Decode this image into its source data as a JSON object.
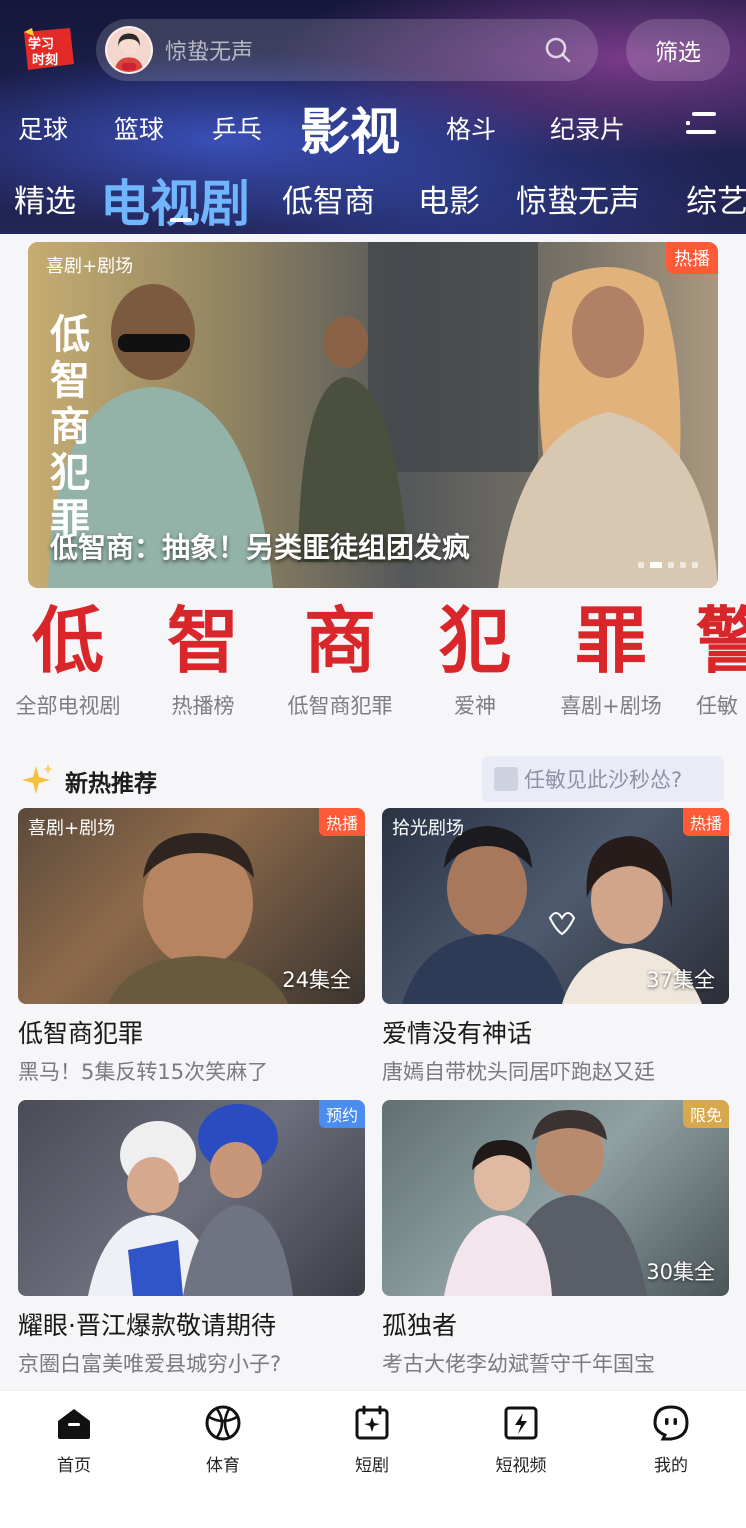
{
  "header": {
    "logo_text": "学习时刻",
    "search_placeholder": "惊蛰无声",
    "filter_label": "筛选",
    "channels": [
      "足球",
      "篮球",
      "乒乓",
      "影视",
      "格斗",
      "纪录片"
    ],
    "categories": [
      "精选",
      "电视剧",
      "低智商",
      "电影",
      "惊蛰无声",
      "综艺"
    ]
  },
  "banner": {
    "badge": "热播",
    "logo_text": "喜剧+剧场",
    "calligraphy": "低智商犯罪",
    "title": "低智商：抽象！另类匪徒组团发疯"
  },
  "shortcuts": [
    {
      "glyph": "低",
      "label": "全部电视剧"
    },
    {
      "glyph": "智",
      "label": "热播榜"
    },
    {
      "glyph": "商",
      "label": "低智商犯罪"
    },
    {
      "glyph": "犯",
      "label": "爱神"
    },
    {
      "glyph": "罪",
      "label": "喜剧+剧场"
    },
    {
      "glyph": "警",
      "label": "任敏"
    }
  ],
  "section": {
    "title": "新热推荐",
    "search_hint": "任敏见此沙秒怂?"
  },
  "cards": [
    {
      "badge": "热播",
      "badge_color": "#ff5a38",
      "brand": "喜剧+剧场",
      "episodes": "24集全",
      "title": "低智商犯罪",
      "subtitle": "黑马！5集反转15次笑麻了"
    },
    {
      "badge": "热播",
      "badge_color": "#ff5a38",
      "brand": "拾光剧场",
      "episodes": "37集全",
      "title": "爱情没有神话",
      "subtitle": "唐嫣自带枕头同居吓跑赵又廷"
    },
    {
      "badge": "预约",
      "badge_color": "#4a8cf0",
      "brand": "",
      "episodes": "",
      "title": "耀眼·晋江爆款敬请期待",
      "subtitle": "京圈白富美唯爱县城穷小子?"
    },
    {
      "badge": "限免",
      "badge_color": "#d7a84c",
      "brand": "",
      "episodes": "30集全",
      "title": "孤独者",
      "subtitle": "考古大佬李幼斌誓守千年国宝"
    }
  ],
  "tabs": [
    "首页",
    "体育",
    "短剧",
    "短视频",
    "我的"
  ]
}
